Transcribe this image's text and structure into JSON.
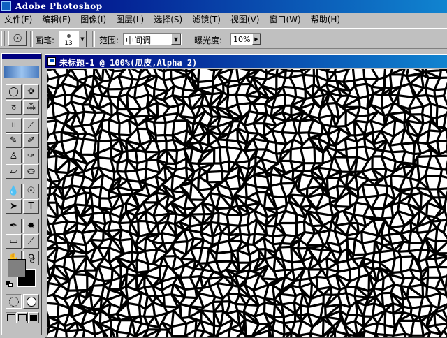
{
  "app": {
    "title": "Adobe Photoshop",
    "icon": "photoshop-app-icon"
  },
  "menu": [
    {
      "id": "file",
      "label": "文件(F)"
    },
    {
      "id": "edit",
      "label": "编辑(E)"
    },
    {
      "id": "image",
      "label": "图像(I)"
    },
    {
      "id": "layer",
      "label": "图层(L)"
    },
    {
      "id": "select",
      "label": "选择(S)"
    },
    {
      "id": "filter",
      "label": "滤镜(T)"
    },
    {
      "id": "view",
      "label": "视图(V)"
    },
    {
      "id": "window",
      "label": "窗口(W)"
    },
    {
      "id": "help",
      "label": "帮助(H)"
    }
  ],
  "options": {
    "tool_icon": "dodge-tool-icon",
    "brush_label": "画笔:",
    "brush_size": "13",
    "range_label": "范围:",
    "range_value": "中间调",
    "exposure_label": "曝光度:",
    "exposure_value": "10%"
  },
  "document": {
    "title": "未标题-1 @ 100%(瓜皮,Alpha 2)",
    "content": "craquelure-cell-pattern",
    "colors": {
      "background": "#ffffff",
      "cells": "#000000"
    }
  },
  "toolbox": {
    "tools": [
      {
        "name": "elliptical-marquee-tool",
        "icon": "elliptical-marquee-icon",
        "glyph": "◯"
      },
      {
        "name": "move-tool",
        "icon": "move-icon",
        "glyph": "✥"
      },
      {
        "name": "lasso-tool",
        "icon": "lasso-icon",
        "glyph": "ჾ"
      },
      {
        "name": "magic-wand-tool",
        "icon": "magic-wand-icon",
        "glyph": "⁂"
      },
      {
        "name": "crop-tool",
        "icon": "crop-icon",
        "glyph": "⌗"
      },
      {
        "name": "slice-tool",
        "icon": "slice-icon",
        "glyph": "⟋"
      },
      {
        "name": "healing-brush-tool",
        "icon": "healing-brush-icon",
        "glyph": "✎"
      },
      {
        "name": "brush-tool",
        "icon": "brush-icon",
        "glyph": "✐"
      },
      {
        "name": "clone-stamp-tool",
        "icon": "clone-stamp-icon",
        "glyph": "♙"
      },
      {
        "name": "history-brush-tool",
        "icon": "history-brush-icon",
        "glyph": "✑"
      },
      {
        "name": "eraser-tool",
        "icon": "eraser-icon",
        "glyph": "▱"
      },
      {
        "name": "paint-bucket-tool",
        "icon": "paint-bucket-icon",
        "glyph": "⛀"
      },
      {
        "name": "blur-tool",
        "icon": "blur-drop-icon",
        "glyph": "💧"
      },
      {
        "name": "dodge-tool",
        "icon": "dodge-icon",
        "glyph": "☉"
      },
      {
        "name": "path-selection-tool",
        "icon": "path-selection-icon",
        "glyph": "➤"
      },
      {
        "name": "type-tool",
        "icon": "type-icon",
        "glyph": "T"
      },
      {
        "name": "pen-tool",
        "icon": "pen-icon",
        "glyph": "✒"
      },
      {
        "name": "custom-shape-tool",
        "icon": "custom-shape-icon",
        "glyph": "✸"
      },
      {
        "name": "notes-tool",
        "icon": "notes-icon",
        "glyph": "▭"
      },
      {
        "name": "eyedropper-tool",
        "icon": "eyedropper-icon",
        "glyph": "⟋"
      },
      {
        "name": "hand-tool",
        "icon": "hand-icon",
        "glyph": "✋"
      },
      {
        "name": "zoom-tool",
        "icon": "zoom-icon",
        "glyph": "⚲"
      }
    ],
    "foreground_color": "#808080",
    "background_color": "#000000"
  }
}
